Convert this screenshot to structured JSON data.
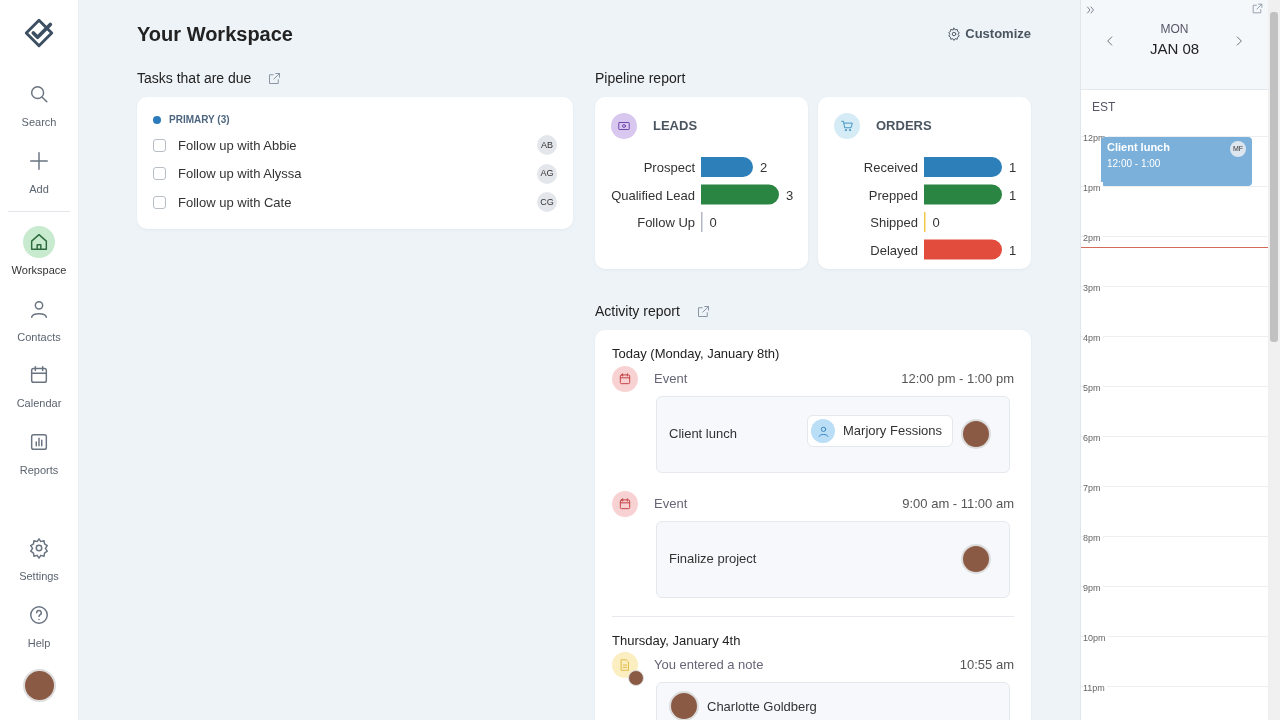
{
  "sidebar": {
    "items": [
      {
        "kind": "search",
        "label": "Search",
        "selected": false
      },
      {
        "kind": "add",
        "label": "Add",
        "selected": false
      },
      {
        "kind": "home",
        "label": "Workspace",
        "selected": true
      },
      {
        "kind": "person",
        "label": "Contacts",
        "selected": false
      },
      {
        "kind": "calendar",
        "label": "Calendar",
        "selected": false
      },
      {
        "kind": "reports",
        "label": "Reports",
        "selected": false
      }
    ],
    "bottom_items": [
      {
        "kind": "settings",
        "label": "Settings",
        "selected": false
      },
      {
        "kind": "help",
        "label": "Help",
        "selected": false
      }
    ]
  },
  "header": {
    "title": "Your Workspace",
    "customize": "Customize"
  },
  "tasks": {
    "title": "Tasks that are due",
    "group": "PRIMARY (3)",
    "items": [
      {
        "label": "Follow up with Abbie",
        "initials": "AB",
        "checked": false
      },
      {
        "label": "Follow up with Alyssa",
        "initials": "AG",
        "checked": false
      },
      {
        "label": "Follow up with Cate",
        "initials": "CG",
        "checked": false
      }
    ]
  },
  "pipeline": {
    "title": "Pipeline report",
    "cards": [
      {
        "kind": "leads",
        "title": "LEADS",
        "chart_data": {
          "type": "bar",
          "orientation": "horizontal",
          "stacked": true,
          "data_labels": true,
          "categories": [
            "Prospect",
            "Qualified Lead",
            "Follow Up"
          ],
          "series": [
            {
              "color": "#2c7fb8",
              "values": [
                2,
                null,
                null
              ]
            },
            {
              "color": "#2a8442",
              "values": [
                null,
                3,
                null
              ]
            },
            {
              "color": "#b4b8c4",
              "values": [
                null,
                null,
                0
              ]
            }
          ]
        }
      },
      {
        "kind": "orders",
        "title": "ORDERS",
        "chart_data": {
          "type": "bar",
          "orientation": "horizontal",
          "stacked": true,
          "data_labels": true,
          "categories": [
            "Received",
            "Prepped",
            "Shipped",
            "Delayed"
          ],
          "series": [
            {
              "color": "#2c7fb8",
              "values": [
                1,
                null,
                null,
                null
              ]
            },
            {
              "color": "#2a8442",
              "values": [
                null,
                1,
                null,
                null
              ]
            },
            {
              "color": "#f0c94a",
              "values": [
                null,
                null,
                0,
                null
              ]
            },
            {
              "color": "#e24c3c",
              "values": [
                null,
                null,
                null,
                1
              ]
            }
          ]
        }
      }
    ]
  },
  "activity": {
    "title": "Activity report",
    "days": [
      {
        "heading": "Today (Monday, January 8th)",
        "items": [
          {
            "kind": "event",
            "label": "Event",
            "time": "12:00 pm - 1:00 pm",
            "card": {
              "title": "Client lunch",
              "contact": "Marjory Fessions"
            }
          },
          {
            "kind": "event",
            "label": "Event",
            "time": "9:00 am - 11:00 am",
            "card": {
              "title": "Finalize project"
            }
          }
        ]
      },
      {
        "heading": "Thursday, January 4th",
        "items": [
          {
            "kind": "note",
            "label": "You entered a note",
            "time": "10:55 am",
            "card": {
              "author": "Charlotte Goldberg"
            }
          }
        ]
      }
    ]
  },
  "calendar": {
    "weekday": "MON",
    "date": "JAN 08",
    "timezone": "EST",
    "hours": [
      {
        "label": "12pm",
        "events": [
          {
            "title": "Client lunch",
            "time": "12:00 - 1:00",
            "initials": "MF"
          }
        ]
      },
      {
        "label": "1pm"
      },
      {
        "label": "2pm"
      },
      {
        "label": "3pm"
      },
      {
        "label": "4pm"
      },
      {
        "label": "5pm"
      },
      {
        "label": "6pm"
      },
      {
        "label": "7pm"
      },
      {
        "label": "8pm"
      },
      {
        "label": "9pm"
      },
      {
        "label": "10pm"
      },
      {
        "label": "11pm"
      }
    ]
  }
}
